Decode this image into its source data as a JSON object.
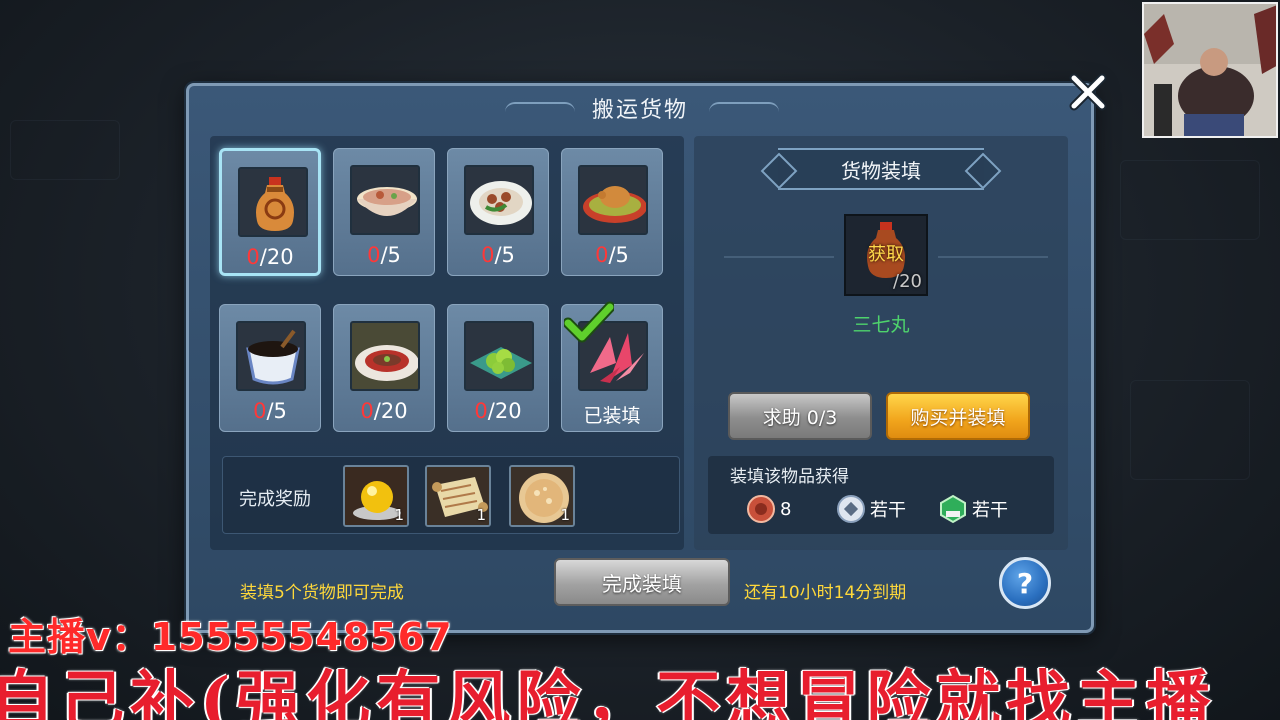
{
  "dialog": {
    "title": "搬运货物"
  },
  "items": [
    {
      "icon": "medicine-bottle-icon",
      "have": "0",
      "need": "/20",
      "selected": true
    },
    {
      "icon": "rice-bowl-icon",
      "have": "0",
      "need": "/5"
    },
    {
      "icon": "dumpling-plate-icon",
      "have": "0",
      "need": "/5"
    },
    {
      "icon": "roast-chicken-icon",
      "have": "0",
      "need": "/5"
    },
    {
      "icon": "black-soup-cup-icon",
      "have": "0",
      "need": "/5"
    },
    {
      "icon": "steak-plate-icon",
      "have": "0",
      "need": "/20"
    },
    {
      "icon": "green-vegetable-plate-icon",
      "have": "0",
      "need": "/20"
    },
    {
      "icon": "red-crystal-icon",
      "status": "已装填",
      "loaded": true
    }
  ],
  "reward": {
    "label": "完成奖励",
    "slots": [
      {
        "icon": "gold-orb-icon",
        "qty": "1"
      },
      {
        "icon": "scroll-icon",
        "qty": "1"
      },
      {
        "icon": "pastry-icon",
        "qty": "1"
      }
    ]
  },
  "cargo": {
    "section_title": "货物装填",
    "obtain_label": "获取",
    "count": "/20",
    "name": "三七丸",
    "help_button": "求助 0/3",
    "buy_button": "购买并装填",
    "gain_title": "装填该物品获得",
    "gains": [
      {
        "icon": "copper-coin-icon",
        "value": "8"
      },
      {
        "icon": "silver-coin-icon",
        "value": "若干"
      },
      {
        "icon": "exp-gem-icon",
        "value": "若干"
      }
    ]
  },
  "footer": {
    "tip": "装填5个货物即可完成",
    "complete_button": "完成装填",
    "expire": "还有10小时14分到期",
    "help": "?"
  },
  "overlay": {
    "streamer": "主播v：15555548567",
    "warning": "自己补(强化有风险，不想冒险就找主播"
  },
  "colors": {
    "have_count": "#ff3838",
    "item_name": "#4ed36c",
    "tip_text": "#ffd83a",
    "buy_button": "#f1a51c",
    "overlay_red": "#e81e2e"
  }
}
